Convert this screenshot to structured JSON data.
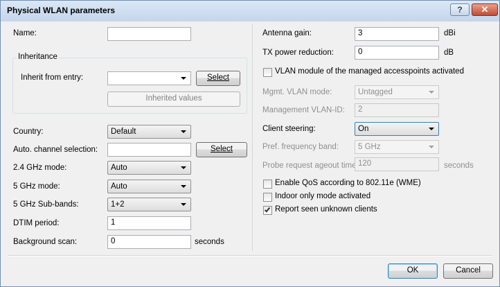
{
  "window": {
    "title": "Physical WLAN parameters",
    "help_glyph": "?",
    "close_glyph": "✕"
  },
  "left": {
    "name_label": "Name:",
    "name_value": "",
    "inheritance": {
      "group_title": "Inheritance",
      "inherit_from_label": "Inherit from entry:",
      "inherit_from_value": "",
      "select_label": "Select",
      "inherited_values_label": "Inherited values"
    },
    "country_label": "Country:",
    "country_value": "Default",
    "auto_channel_label": "Auto. channel selection:",
    "auto_channel_value": "",
    "auto_channel_select_label": "Select",
    "mode24_label": "2.4 GHz mode:",
    "mode24_value": "Auto",
    "mode5_label": "5 GHz mode:",
    "mode5_value": "Auto",
    "subbands_label": "5 GHz Sub-bands:",
    "subbands_value": "1+2",
    "dtim_label": "DTIM period:",
    "dtim_value": "1",
    "bgscan_label": "Background scan:",
    "bgscan_value": "0",
    "bgscan_unit": "seconds"
  },
  "right": {
    "antenna_gain_label": "Antenna gain:",
    "antenna_gain_value": "3",
    "antenna_gain_unit": "dBi",
    "tx_power_label": "TX power reduction:",
    "tx_power_value": "0",
    "tx_power_unit": "dB",
    "vlan_module_label": "VLAN module of the managed accesspoints activated",
    "vlan_module_checked": false,
    "mgmt_vlan_mode_label": "Mgmt. VLAN mode:",
    "mgmt_vlan_mode_value": "Untagged",
    "mgmt_vlan_id_label": "Management VLAN-ID:",
    "mgmt_vlan_id_value": "2",
    "client_steering_label": "Client steering:",
    "client_steering_value": "On",
    "pref_band_label": "Pref. frequency band:",
    "pref_band_value": "5 GHz",
    "probe_label": "Probe request ageout time:",
    "probe_value": "120",
    "probe_unit": "seconds",
    "qos_label": "Enable QoS according to 802.11e (WME)",
    "qos_checked": false,
    "indoor_label": "Indoor only mode activated",
    "indoor_checked": false,
    "report_label": "Report seen unknown clients",
    "report_checked": true
  },
  "footer": {
    "ok_label": "OK",
    "cancel_label": "Cancel"
  }
}
